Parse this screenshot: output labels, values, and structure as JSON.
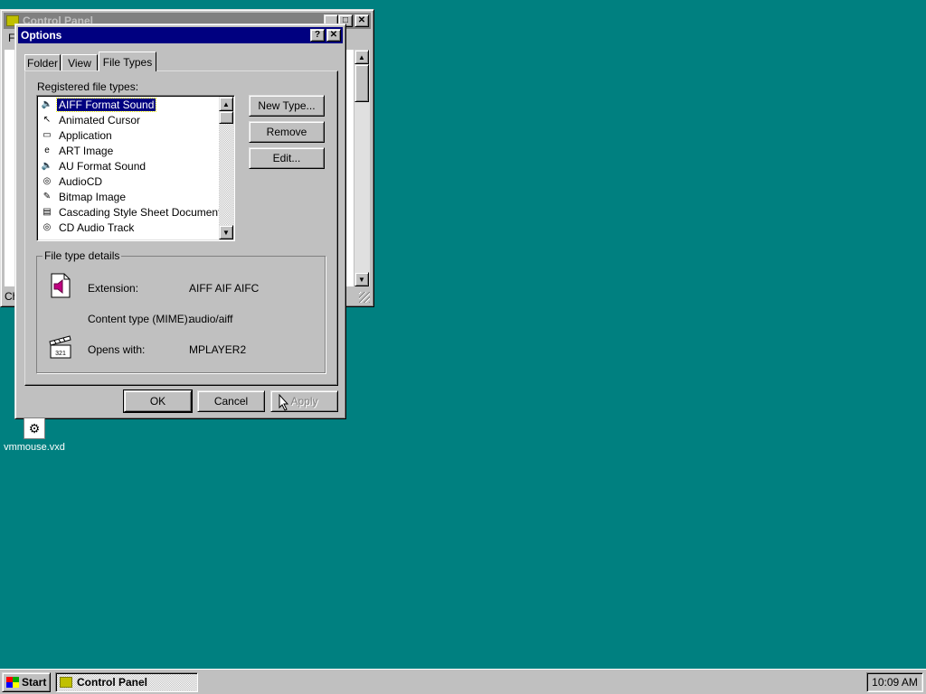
{
  "control_panel": {
    "title": "Control Panel",
    "menu_letter": "F",
    "status_text": "Ch"
  },
  "dialog": {
    "title": "Options",
    "tabs": [
      {
        "label": "Folder"
      },
      {
        "label": "View"
      },
      {
        "label": "File Types"
      }
    ],
    "registered_label": "Registered file types:",
    "file_types": [
      {
        "label": "AIFF Format Sound",
        "icon": "speaker-icon"
      },
      {
        "label": "Animated Cursor",
        "icon": "cursor-icon"
      },
      {
        "label": "Application",
        "icon": "window-icon"
      },
      {
        "label": "ART Image",
        "icon": "ie-icon"
      },
      {
        "label": "AU Format Sound",
        "icon": "speaker-icon"
      },
      {
        "label": "AudioCD",
        "icon": "cd-icon"
      },
      {
        "label": "Bitmap Image",
        "icon": "paint-icon"
      },
      {
        "label": "Cascading Style Sheet Document",
        "icon": "document-icon"
      },
      {
        "label": "CD Audio Track",
        "icon": "cd-icon"
      }
    ],
    "buttons": {
      "new_type": "New Type...",
      "remove": "Remove",
      "edit": "Edit..."
    },
    "details": {
      "group_label": "File type details",
      "extension_label": "Extension:",
      "extension_value": "AIFF AIF AIFC",
      "mime_label": "Content type (MIME):",
      "mime_value": "audio/aiff",
      "opens_label": "Opens with:",
      "opens_value": "MPLAYER2"
    },
    "ok": "OK",
    "cancel": "Cancel",
    "apply": "Apply"
  },
  "desktop": {
    "icon_label": "vmmouse.vxd"
  },
  "taskbar": {
    "start": "Start",
    "task": "Control Panel",
    "clock": "10:09 AM"
  }
}
